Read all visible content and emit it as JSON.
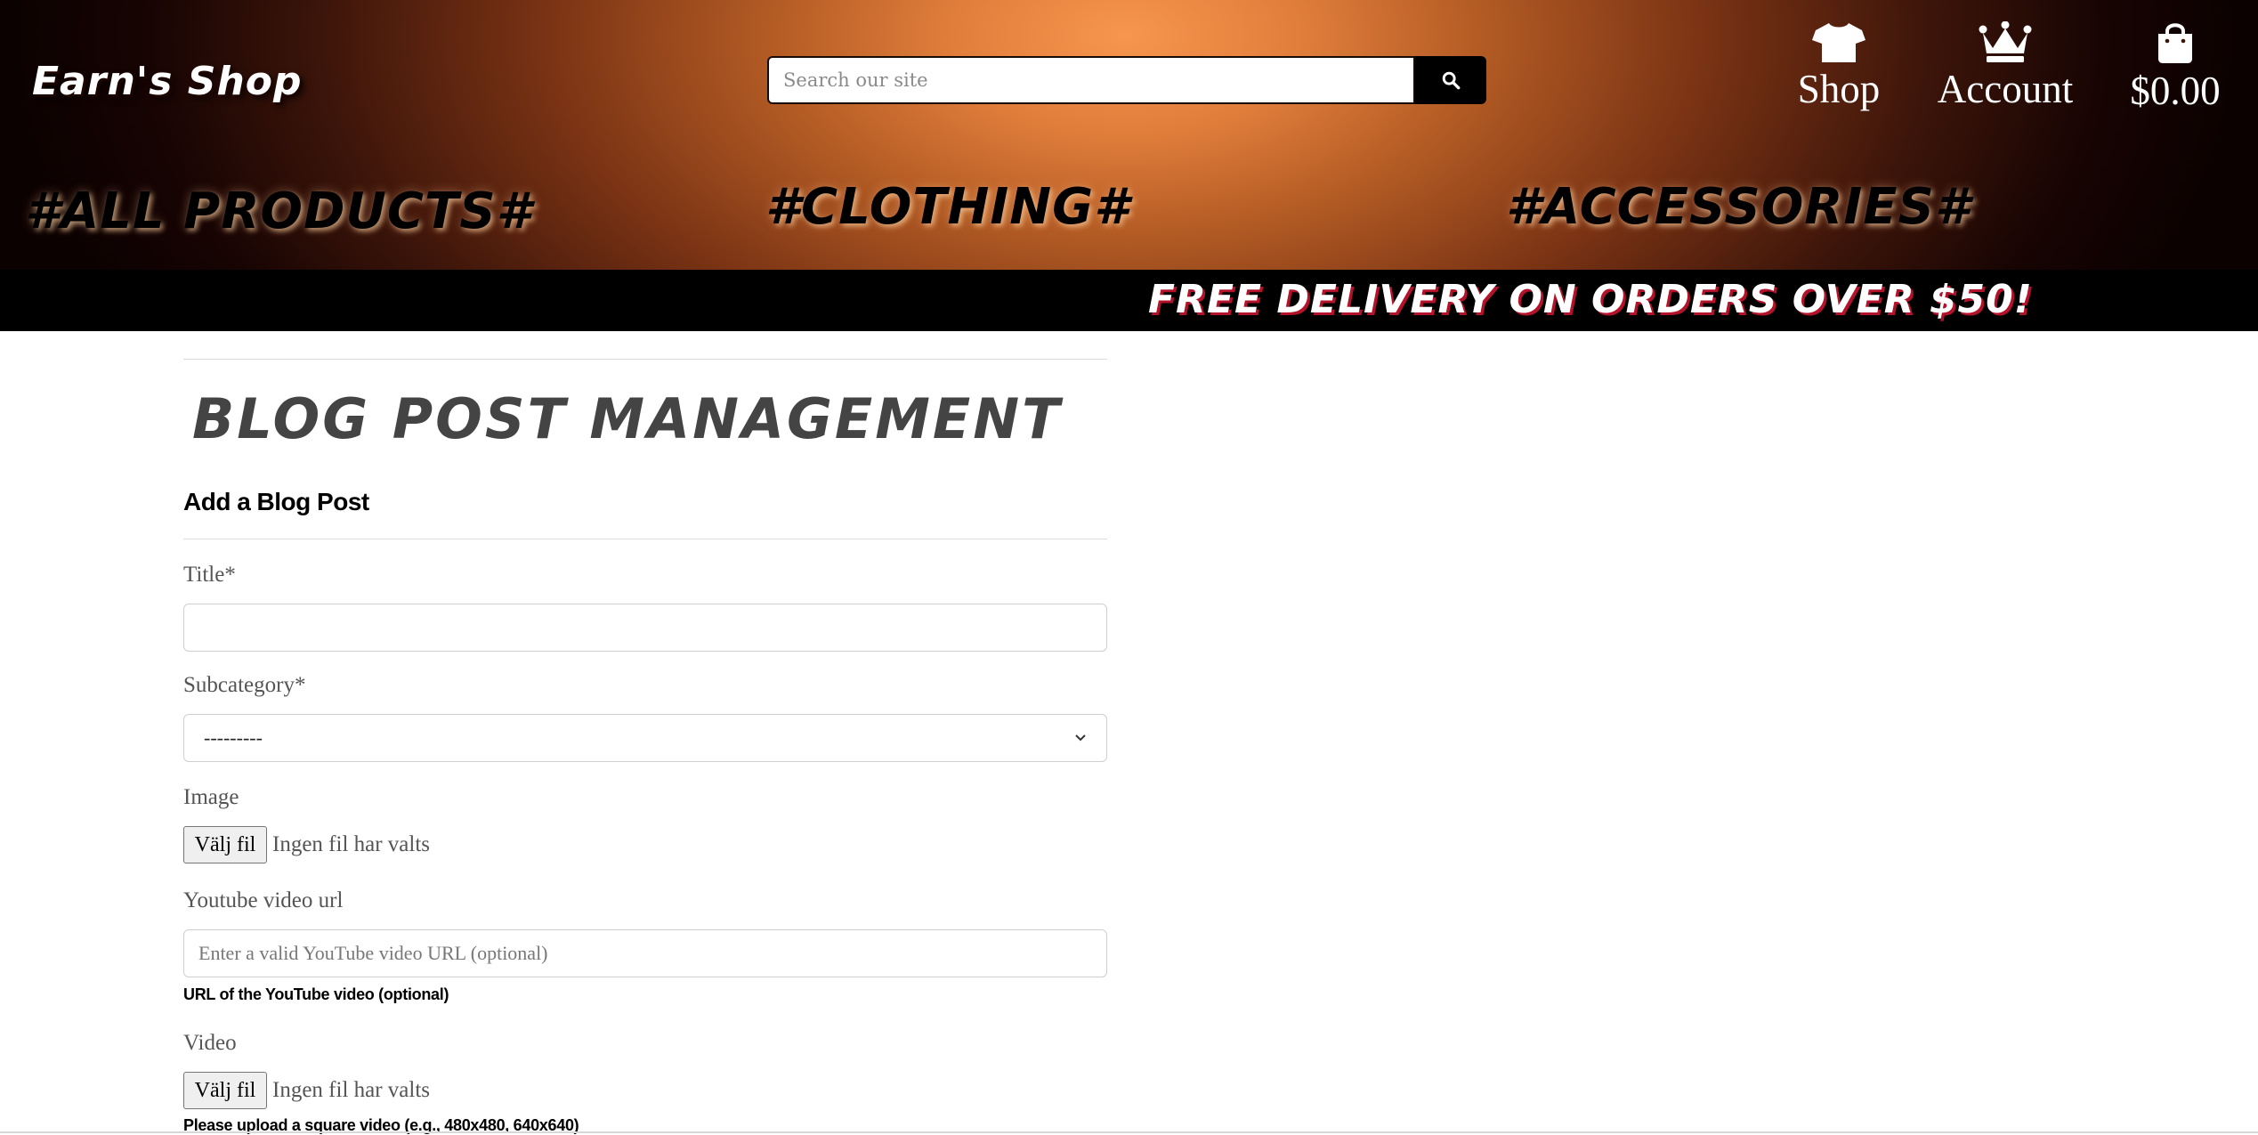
{
  "header": {
    "logo": "Earn's Shop",
    "search": {
      "placeholder": "Search our site"
    },
    "nav": {
      "shop": "Shop",
      "account": "Account",
      "cart_total": "$0.00"
    },
    "categories": [
      "#ALL PRODUCTS#",
      "#CLOTHING#",
      "#ACCESSORIES#"
    ],
    "promo": "FREE DELIVERY ON ORDERS OVER $50!"
  },
  "page": {
    "title": "BLOG POST MANAGEMENT",
    "section_title": "Add a Blog Post"
  },
  "form": {
    "title_label": "Title*",
    "title_value": "",
    "subcategory_label": "Subcategory*",
    "subcategory_selected": "---------",
    "image_label": "Image",
    "file_button": "Välj fil",
    "file_status": "Ingen fil har valts",
    "youtube_label": "Youtube video url",
    "youtube_placeholder": "Enter a valid YouTube video URL (optional)",
    "youtube_help": "URL of the YouTube video (optional)",
    "video_label": "Video",
    "video_help": "Please upload a square video (e.g., 480x480, 640x640)"
  },
  "colors": {
    "header_glow": "#f7964e",
    "header_dark": "#0c0101",
    "promo_bg": "#000000",
    "promo_shadow": "#b3122a"
  },
  "icons": [
    "search-icon",
    "shirt-icon",
    "crown-icon",
    "shopping-bag-icon",
    "chevron-down-icon"
  ]
}
